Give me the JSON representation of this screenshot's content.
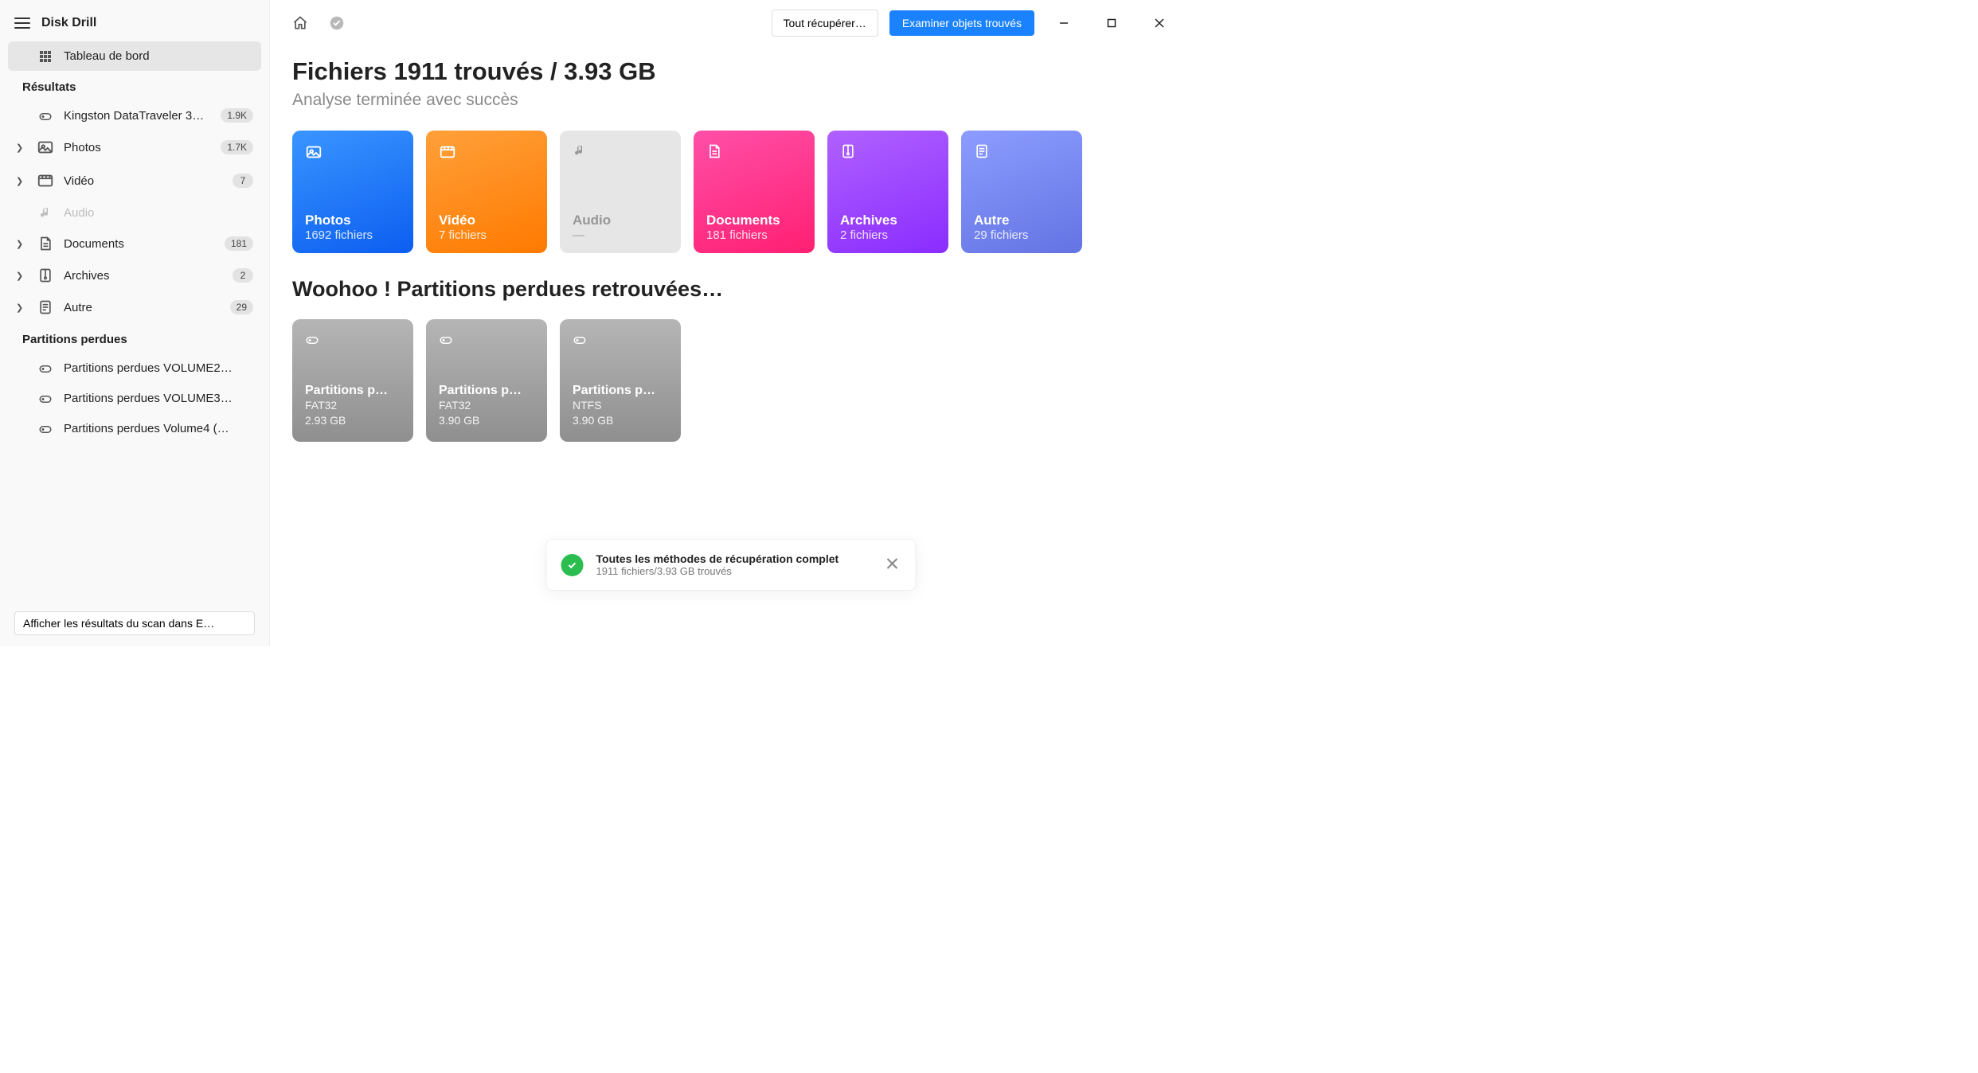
{
  "app_title": "Disk Drill",
  "sidebar": {
    "dashboard_label": "Tableau de bord",
    "results_header": "Résultats",
    "items": [
      {
        "label": "Kingston DataTraveler 3…",
        "badge": "1.9K",
        "has_chevron": false,
        "icon": "drive"
      },
      {
        "label": "Photos",
        "badge": "1.7K",
        "has_chevron": true,
        "icon": "photo"
      },
      {
        "label": "Vidéo",
        "badge": "7",
        "has_chevron": true,
        "icon": "video"
      },
      {
        "label": "Audio",
        "badge": "",
        "has_chevron": false,
        "icon": "audio",
        "disabled": true
      },
      {
        "label": "Documents",
        "badge": "181",
        "has_chevron": true,
        "icon": "doc"
      },
      {
        "label": "Archives",
        "badge": "2",
        "has_chevron": true,
        "icon": "zip"
      },
      {
        "label": "Autre",
        "badge": "29",
        "has_chevron": true,
        "icon": "other"
      }
    ],
    "lost_header": "Partitions perdues",
    "lost_items": [
      {
        "label": "Partitions perdues VOLUME2…"
      },
      {
        "label": "Partitions perdues VOLUME3…"
      },
      {
        "label": "Partitions perdues Volume4 (…"
      }
    ],
    "bottom_link": "Afficher les résultats du scan dans E…"
  },
  "topbar": {
    "recover_all": "Tout récupérer…",
    "review_found": "Examiner objets trouvés"
  },
  "content": {
    "page_title": "Fichiers 1911 trouvés / 3.93 GB",
    "subtitle": "Analyse terminée avec succès",
    "cards": [
      {
        "name": "Photos",
        "sub": "1692 fichiers",
        "bg": "linear-gradient(160deg,#3a95ff,#0b5ef0)",
        "icon": "photo"
      },
      {
        "name": "Vidéo",
        "sub": "7 fichiers",
        "bg": "linear-gradient(160deg,#ffa03a,#ff7a00)",
        "icon": "video"
      },
      {
        "name": "Audio",
        "sub": "—",
        "bg": "#e6e6e6",
        "disabled": true,
        "icon": "audio"
      },
      {
        "name": "Documents",
        "sub": "181 fichiers",
        "bg": "linear-gradient(160deg,#ff4fa8,#ff1f72)",
        "icon": "doc"
      },
      {
        "name": "Archives",
        "sub": "2 fichiers",
        "bg": "linear-gradient(160deg,#b061ff,#8a2cff)",
        "icon": "zip"
      },
      {
        "name": "Autre",
        "sub": "29 fichiers",
        "bg": "linear-gradient(160deg,#8c9cff,#6374e3)",
        "icon": "other"
      }
    ],
    "partitions_title": "Woohoo ! Partitions perdues retrouvées…",
    "partitions": [
      {
        "name": "Partitions p…",
        "fs": "FAT32",
        "size": "2.93 GB"
      },
      {
        "name": "Partitions p…",
        "fs": "FAT32",
        "size": "3.90 GB"
      },
      {
        "name": "Partitions p…",
        "fs": "NTFS",
        "size": "3.90 GB"
      }
    ]
  },
  "toast": {
    "title": "Toutes les méthodes de récupération complet",
    "subtitle": "1911 fichiers/3.93 GB trouvés"
  }
}
